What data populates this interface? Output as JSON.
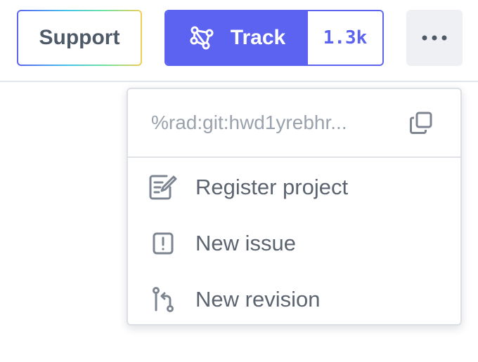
{
  "toolbar": {
    "support_label": "Support",
    "track_label": "Track",
    "track_count": "1.3k",
    "more_label": "More"
  },
  "menu": {
    "id_text": "%rad:git:hwd1yrebhr...",
    "items": [
      {
        "label": "Register project",
        "icon": "edit-icon"
      },
      {
        "label": "New issue",
        "icon": "issue-icon"
      },
      {
        "label": "New revision",
        "icon": "revision-icon"
      }
    ]
  },
  "colors": {
    "accent": "#5b63f0",
    "text_muted": "#9aa2ad",
    "text": "#5c6470",
    "button_bg": "#eef0f3"
  }
}
